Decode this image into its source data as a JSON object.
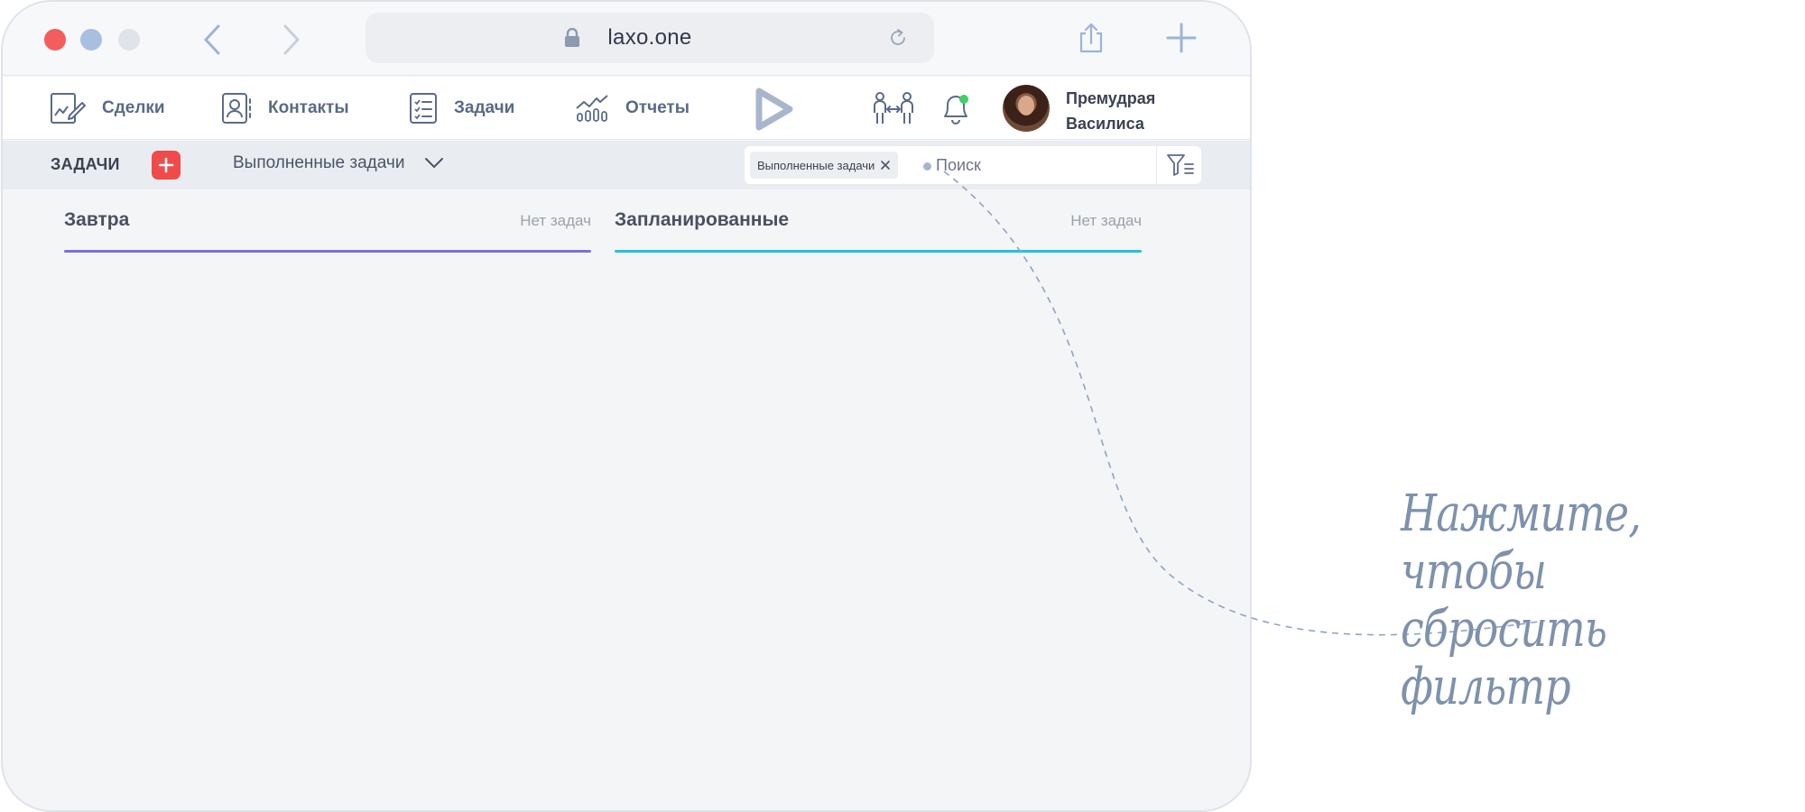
{
  "browser": {
    "url": "laxo.one"
  },
  "nav": {
    "items": [
      {
        "label": "Сделки",
        "icon": "deals-icon"
      },
      {
        "label": "Контакты",
        "icon": "contacts-icon"
      },
      {
        "label": "Задачи",
        "icon": "tasks-icon"
      },
      {
        "label": "Отчеты",
        "icon": "reports-icon"
      }
    ],
    "notification_dot_color": "#3ecf6b"
  },
  "user": {
    "first_line": "Премудрая",
    "second_line": "Василиса"
  },
  "toolbar": {
    "title": "ЗАДАЧИ",
    "filter_selected": "Выполненные задачи",
    "add_color": "#ef4b4b"
  },
  "search": {
    "chip_label": "Выполненные задачи",
    "placeholder": "Поиск"
  },
  "columns": [
    {
      "title": "Завтра",
      "status": "Нет задач",
      "accent": "#7b6fe0"
    },
    {
      "title": "Запланированные",
      "status": "Нет задач",
      "accent": "#22c1e0"
    }
  ],
  "annotation": {
    "line1": "Нажмите, чтобы",
    "line2": "сбросить фильтр"
  }
}
